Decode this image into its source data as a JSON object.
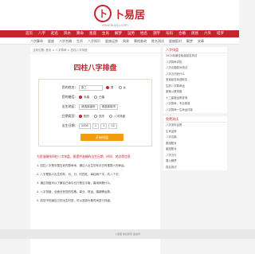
{
  "site": {
    "logo_char": "卜",
    "name": "卜易居",
    "url": "www.buyiju.com"
  },
  "nav": [
    "首页",
    "八字",
    "起名",
    "风水",
    "算命",
    "星座",
    "生肖",
    "解梦",
    "运势",
    "姓名",
    "测字",
    "号码",
    "合婚",
    "周易",
    "六爻",
    "塔罗"
  ],
  "subnav": [
    "八字算命",
    "星座",
    "八字合婚",
    "生肖",
    "八字知识",
    "星座运势",
    "周易",
    "属相查询",
    "姓名测试",
    "星座配对",
    "解梦",
    "文章"
  ],
  "breadcrumb": "当前位置: 首页 > 八字算命 > 四柱八字排盘",
  "panel": {
    "title": "四柱八字排盘",
    "name_label": "您的姓名:",
    "name_value": "张三",
    "gender_label": "您的性别:",
    "gender_male": "男",
    "gender_female": "女",
    "marriage_label": "您的婚否:",
    "marriage_no": "未婚",
    "marriage_yes": "已婚",
    "birthplace_label": "出生地区:",
    "birthplace_value": "请选择省份",
    "birthplace_value2": "请选择城市",
    "calendar_label": "日期类型:",
    "calendar_solar": "阳历",
    "calendar_lunar": "农历",
    "calendar_other": "八字排盘",
    "date_label": "出生日期:",
    "year": "2005",
    "month": "1",
    "day": "1",
    "hour": "12",
    "submit_label": "开始排盘"
  },
  "tip": "为您准确排四柱八字排盘，需提供准确的出生日期、时间、地点等信息",
  "paragraphs": [
    "1. 四柱八字是中国古老的算命术，通过人出生的年月日时推算人的命运。",
    "2. 八字是指人出生的年、月、日、时四柱，每柱两个字，共八个字。",
    "3. 通过排盘可以了解自己命中五行是否平衡，喜用神是什么。",
    "4. 八字排盘，全面分析您的性格、事业、财运、婚姻等运势。",
    "5. 若您不知道自己的出生时辰，可以选择大概时间进行排盘。"
  ],
  "side": [
    {
      "title": "八字排盘",
      "items": [
        "2025年最佳免费起名测试",
        "八字算命详批",
        "八字合婚配对测试",
        "八字五行缺什么",
        "宝宝起名免费取名",
        "生辰八字算命运",
        "紫微斗数排盘",
        "十二星座运势查询",
        "八字算命，专业精准",
        "八字算命一生命运详批"
      ]
    },
    {
      "title": "免费测试",
      "items": [
        "八字流年运势",
        "生肖运势",
        "八字合婚",
        "属相配对",
        "星座配对",
        "八字五行",
        "周公解梦",
        "姓名测试"
      ]
    }
  ],
  "footer": "卜易居 版权所有 备案号"
}
